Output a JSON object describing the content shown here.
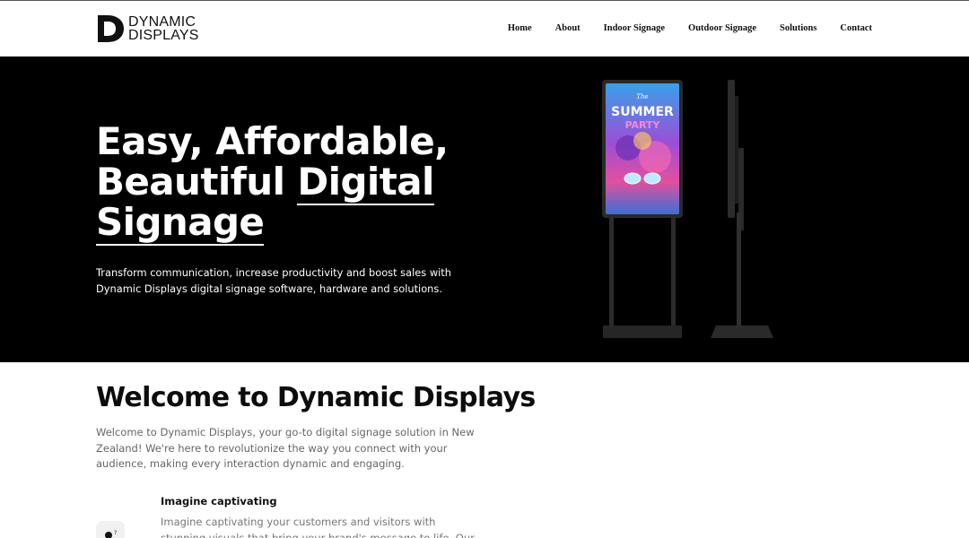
{
  "brand": {
    "line1": "DYNAMIC",
    "line2": "DISPLAYS"
  },
  "nav": {
    "items": [
      "Home",
      "About",
      "Indoor Signage",
      "Outdoor Signage",
      "Solutions",
      "Contact"
    ]
  },
  "hero": {
    "title_line1": "Easy, Affordable,",
    "title_line2_a": "Beautiful ",
    "title_line2_b": "Digital",
    "title_line3": "Signage",
    "subtitle": "Transform communication, increase productivity and boost sales with Dynamic Displays digital signage software, hardware and solutions.",
    "screen_text_small": "The",
    "screen_text_big": "SUMMER",
    "screen_text_sub": "PARTY"
  },
  "welcome": {
    "title": "Welcome to Dynamic Displays",
    "text": "Welcome to Dynamic Displays, your go-to digital signage solution in New Zealand! We're here to revolutionize the way you connect with your audience, making every interaction dynamic and engaging."
  },
  "feature": {
    "title": "Imagine captivating",
    "text": "Imagine captivating your customers and visitors with stunning visuals that bring your brand's message to life. Our innovative",
    "icon": "idea-icon"
  },
  "colors": {
    "hero_bg": "#000000",
    "text_dark": "#111111",
    "text_muted": "#666666"
  }
}
